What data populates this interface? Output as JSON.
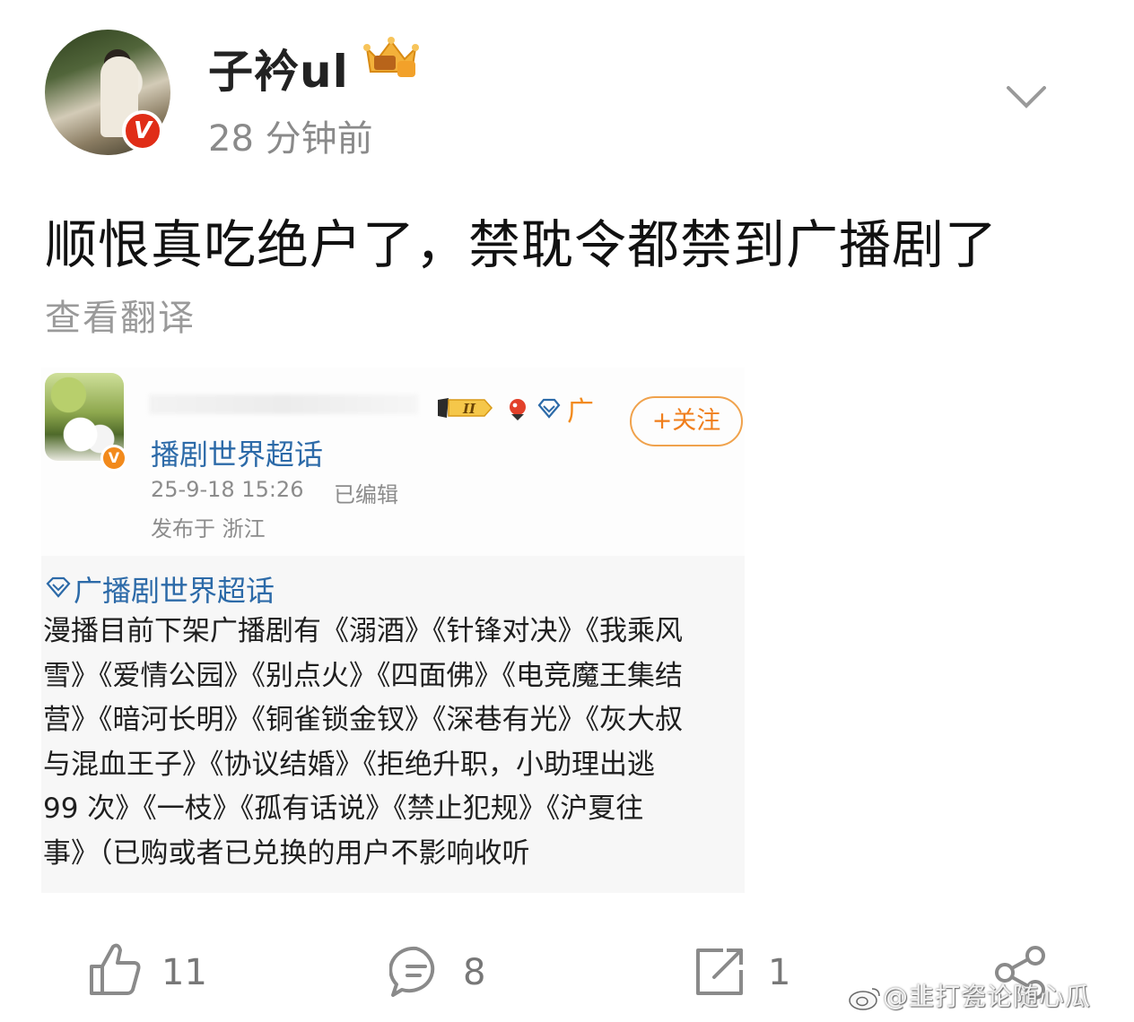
{
  "header": {
    "username": "子衿ul",
    "timestamp": "28 分钟前",
    "verified_badge": "V",
    "icons": [
      "vip-crown-icon",
      "chevron-down-icon"
    ]
  },
  "post": {
    "text": "顺恨真吃绝户了，禁耽令都禁到广播剧了",
    "translate_label": "查看翻译"
  },
  "embedded": {
    "ad_char": "广",
    "level_badge": "II",
    "follow_label": "+关注",
    "topic_name": "播剧世界超话",
    "date": "25-9-18 15:26",
    "edited": "已编辑",
    "location": "发布于 浙江",
    "topic_link": "广播剧世界超话",
    "avatar_badge": "V",
    "body_lines": [
      "漫播目前下架广播剧有《溺酒》《针锋对决》《我乘风",
      "雪》《爱情公园》《别点火》《四面佛》《电竞魔王集结",
      "营》《暗河长明》《铜雀锁金钗》《深巷有光》《灰大叔",
      "与混血王子》《协议结婚》《拒绝升职，小助理出逃",
      "99 次》《一枝》《孤有话说》《禁止犯规》《沪夏往",
      "事》（已购或者已兑换的用户不影响收听"
    ]
  },
  "actions": {
    "like_count": "11",
    "comment_count": "8",
    "repost_count": "1"
  },
  "watermark": "@韭打瓷论随心瓜",
  "colors": {
    "link_blue": "#2c6aa8",
    "accent_orange": "#f07e1c",
    "verified_red": "#e02d17",
    "muted_gray": "#8a8a8a"
  }
}
